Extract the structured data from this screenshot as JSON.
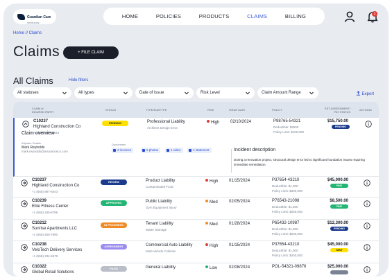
{
  "brand": {
    "name": "Guardian Care",
    "tagline": "INSURANCE"
  },
  "nav": {
    "items": [
      "HOME",
      "POLICIES",
      "PRODUCTS",
      "CLAIMS",
      "BILLING"
    ],
    "active": "CLAIMS"
  },
  "header": {
    "notification_count": "1"
  },
  "breadcrumb": "Home // Claims",
  "page_title": "Claims",
  "file_claim_label": "+ FILE CLAIM",
  "section_title": "All Claims",
  "hide_filters_label": "Hide filters",
  "filters": [
    "All statuses",
    "All types",
    "Date of Issue",
    "Risk Level",
    "Claim Amount Range"
  ],
  "export_label": "Export",
  "columns": {
    "claim": "CLAIM #/",
    "insured": "INSURED PARTY",
    "status": "STATUS",
    "type": "TYPE/SUBTYPE",
    "risk": "RISK",
    "issue_date": "ISSUE DATE",
    "policy": "POLICY",
    "est": "EST ASSESSMENT/",
    "pay_status": "PAY STATUS",
    "actions": "ACTIONS"
  },
  "expanded": {
    "overview_title": "Claim overview",
    "adjuster_label": "Adjuster Details",
    "adjuster_name": "Mark Reynolds",
    "adjuster_email": "mark.reynolds@insuranceco.com",
    "documents_label": "Documents",
    "documents": [
      "3 invoices",
      "5 photos",
      "1 video",
      "1 statement"
    ],
    "incident_title": "Incident description",
    "incident_text": "During a renovation project, structural design error led to significant foundation issues requiring immediate remediation."
  },
  "rows": [
    {
      "id": "C10237",
      "name": "Highland Construction Co",
      "phone": "+1 (555) 987-6543",
      "status": "PENDING",
      "status_bg": "#ffe000",
      "status_fg": "#1b1f2a",
      "type": "Professional Liability",
      "subtype": "Architect Design Error",
      "risk": "High",
      "risk_color": "#e23a3a",
      "date": "02/10/2024",
      "policy": "P98765-54321",
      "deductible": "Deductible: $2500",
      "limit": "Policy Limit: $100,000",
      "amount": "$15,750.00",
      "pay": "PENDING",
      "pay_bg": "#1b3a8c",
      "pay_fg": "#ffffff",
      "expanded": true
    },
    {
      "id": "C10237",
      "name": "Highland Construction Co",
      "phone": "+1 (555) 987-6543",
      "status": "REVIEW",
      "status_bg": "#1b3a8c",
      "status_fg": "#ffffff",
      "type": "Product Liability",
      "subtype": "Contaminated Food",
      "risk": "High",
      "risk_color": "#e23a3a",
      "date": "01/15/2024",
      "policy": "P37654-43210",
      "deductible": "Deductible: $1,000",
      "limit": "Policy Limit: $300,000",
      "amount": "$45,000.00",
      "pay": "PAID",
      "pay_bg": "#22b573",
      "pay_fg": "#ffffff"
    },
    {
      "id": "C10239",
      "name": "Elite Fitness Center",
      "phone": "+1 (555) 345-6789",
      "status": "APPROVED",
      "status_bg": "#22b573",
      "status_fg": "#ffffff",
      "type": "Public Liability",
      "subtype": "Gym Equipment Injury",
      "risk": "Med",
      "risk_color": "#f08a24",
      "date": "02/05/2024",
      "policy": "P76543-21098",
      "deductible": "Deductible: $1,000",
      "limit": "Policy Limit: $250,000",
      "amount": "$8,500.00",
      "pay": "PAID",
      "pay_bg": "#22b573",
      "pay_fg": "#ffffff"
    },
    {
      "id": "C10212",
      "name": "Sunrise Apartments LLC",
      "phone": "+1 (555) 456-7890",
      "status": "IN PROGRESS",
      "status_bg": "#f08a24",
      "status_fg": "#ffffff",
      "type": "Tenant Liability",
      "subtype": "Water Damage",
      "risk": "Med",
      "risk_color": "#f08a24",
      "date": "01/28/2024",
      "policy": "P65432-10987",
      "deductible": "Deductible: $1,000",
      "limit": "Policy Limit: $250,000",
      "amount": "$12,300.00",
      "pay": "PENDING",
      "pay_bg": "#1b3a8c",
      "pay_fg": "#ffffff"
    },
    {
      "id": "C10238",
      "name": "VeloTech Delivery Services",
      "phone": "+1 (555) 234-5678",
      "status": "ASSESSMENT",
      "status_bg": "#9b8cf0",
      "status_fg": "#ffffff",
      "type": "Commercial Auto Liability",
      "subtype": "Multi-Vehicle Collision",
      "risk": "High",
      "risk_color": "#e23a3a",
      "date": "01/15/2024",
      "policy": "P37654-43210",
      "deductible": "Deductible: $1,000",
      "limit": "Policy Limit: $250,000",
      "amount": "$45,000.00",
      "pay": "SENT",
      "pay_bg": "#ffe000",
      "pay_fg": "#1b1f2a"
    },
    {
      "id": "C10322",
      "name": "Global Retail Solutions",
      "phone": "",
      "status": "FILED",
      "status_bg": "#b9bec8",
      "status_fg": "#ffffff",
      "type": "General Liability",
      "subtype": "",
      "risk": "Low",
      "risk_color": "#22b573",
      "date": "02/08/2024",
      "policy": "POL-54321-09876",
      "deductible": "",
      "limit": "",
      "amount": "$25,000.00",
      "pay": "",
      "pay_bg": "#7a8394",
      "pay_fg": "#ffffff"
    }
  ]
}
